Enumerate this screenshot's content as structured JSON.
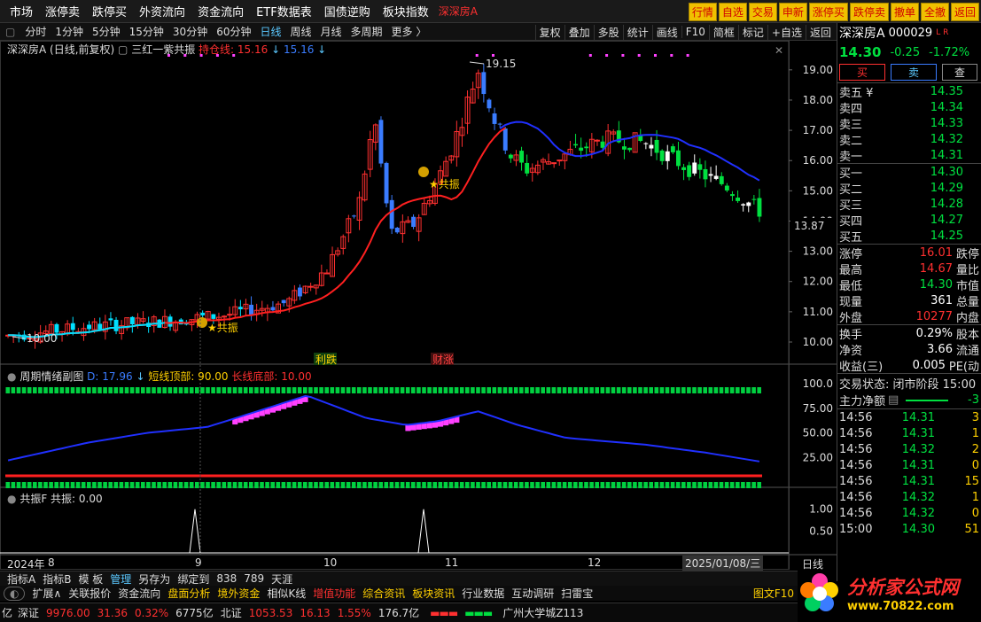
{
  "top_menu": {
    "items": [
      "市场",
      "涨停卖",
      "跌停买",
      "外资流向",
      "资金流向",
      "ETF数据表",
      "国债逆购",
      "板块指数"
    ],
    "stock_code": "深深房A"
  },
  "top_buttons": [
    "行情",
    "自选",
    "交易",
    "申新",
    "涨停买",
    "跌停卖",
    "撤单",
    "全撤",
    "返回"
  ],
  "period_bar": {
    "items": [
      "分时",
      "1分钟",
      "5分钟",
      "15分钟",
      "30分钟",
      "60分钟",
      "日线",
      "周线",
      "月线",
      "多周期",
      "更多 〉"
    ],
    "active": "日线"
  },
  "tool_buttons": [
    "复权",
    "叠加",
    "多股",
    "统计",
    "画线",
    "F10",
    "简框",
    "标记",
    "+自选",
    "返回"
  ],
  "main_legend": {
    "title": "深深房A (日线,前复权)",
    "indicator": "三红一紫共振",
    "hold_label": "持仓线: 15.16",
    "hold_value2": "15.16"
  },
  "price_labels": {
    "high": "19.15",
    "low": "10.00",
    "current": "13.87",
    "resonance1": "★共振",
    "resonance2": "★共振",
    "event1": "利跌",
    "event2": "财涨"
  },
  "price_axis": [
    "19.00",
    "18.00",
    "17.00",
    "16.00",
    "15.00",
    "14.00",
    "13.00",
    "12.00",
    "11.00",
    "10.00"
  ],
  "sub1_legend": {
    "title": "周期情绪副图",
    "d": "D: 17.96",
    "top": "短线顶部: 90.00",
    "bottom": "长线底部: 10.00"
  },
  "sub1_axis": [
    "100.0",
    "75.00",
    "50.00",
    "25.00"
  ],
  "sub2_legend": {
    "title": "共振F",
    "value": "共振: 0.00"
  },
  "sub2_axis": [
    "1.00",
    "0.50"
  ],
  "date_axis": {
    "year": "2024年",
    "months": [
      "8",
      "9",
      "10",
      "11",
      "12"
    ],
    "cursor_date": "2025/01/08/三",
    "period": "日线"
  },
  "chart_data": {
    "type": "candlestick",
    "title": "深深房A (日线,前复权)",
    "ylim": [
      10.0,
      19.2
    ],
    "high": 19.15,
    "low": 10.0,
    "last_marker": 13.87
  },
  "quote": {
    "name": "深深房A",
    "code": "000029",
    "flag": "L R",
    "price": "14.30",
    "change": "-0.25",
    "pct": "-1.72%",
    "buy_btn": "买",
    "sell_btn": "卖",
    "query_btn": "查",
    "asks": [
      {
        "l": "卖五 ¥",
        "v": "14.35",
        "c": "green"
      },
      {
        "l": "卖四",
        "v": "14.34",
        "c": "green"
      },
      {
        "l": "卖三",
        "v": "14.33",
        "c": "green"
      },
      {
        "l": "卖二",
        "v": "14.32",
        "c": "green"
      },
      {
        "l": "卖一",
        "v": "14.31",
        "c": "green"
      }
    ],
    "bids": [
      {
        "l": "买一",
        "v": "14.30",
        "c": "green"
      },
      {
        "l": "买二",
        "v": "14.29",
        "c": "green"
      },
      {
        "l": "买三",
        "v": "14.28",
        "c": "green"
      },
      {
        "l": "买四",
        "v": "14.27",
        "c": "green"
      },
      {
        "l": "买五",
        "v": "14.25",
        "c": "green"
      }
    ],
    "stats": [
      {
        "l": "涨停",
        "v": "16.01",
        "c": "red",
        "r": "跌停"
      },
      {
        "l": "最高",
        "v": "14.67",
        "c": "red",
        "r": "量比"
      },
      {
        "l": "最低",
        "v": "14.30",
        "c": "green",
        "r": "市值"
      },
      {
        "l": "现量",
        "v": "361",
        "c": "white",
        "r": "总量"
      },
      {
        "l": "外盘",
        "v": "10277",
        "c": "red",
        "r": "内盘"
      }
    ],
    "stats2": [
      {
        "l": "换手",
        "v": "0.29%",
        "c": "white",
        "r": "股本"
      },
      {
        "l": "净资",
        "v": "3.66",
        "c": "white",
        "r": "流通"
      },
      {
        "l": "收益(三)",
        "v": "0.005",
        "c": "white",
        "r": "PE(动"
      }
    ],
    "trade_status": "交易状态: 闭市阶段 15:00",
    "net_inflow": "主力净额",
    "net_inflow_val": "-3",
    "ticks": [
      {
        "t": "14:56",
        "p": "14.31",
        "v": "3"
      },
      {
        "t": "14:56",
        "p": "14.31",
        "v": "1"
      },
      {
        "t": "14:56",
        "p": "14.32",
        "v": "2"
      },
      {
        "t": "14:56",
        "p": "14.31",
        "v": "0"
      },
      {
        "t": "14:56",
        "p": "14.31",
        "v": "15"
      },
      {
        "t": "14:56",
        "p": "14.32",
        "v": "1"
      },
      {
        "t": "14:56",
        "p": "14.32",
        "v": "0"
      },
      {
        "t": "15:00",
        "p": "14.30",
        "v": "51"
      }
    ]
  },
  "bottom_bar1": [
    "指标A",
    "指标B",
    "模 板",
    "管理",
    "另存为",
    "绑定到",
    "838",
    "789",
    "天涯"
  ],
  "bottom_bar2": [
    "扩展∧",
    "关联报价",
    "资金流向",
    "盘面分析",
    "境外资金",
    "相似K线",
    "增值功能",
    "综合资讯",
    "板块资讯",
    "行业数据",
    "互动调研",
    "扫雷宝",
    "图文F10"
  ],
  "status_bar": {
    "prefix": "亿",
    "sz_label": "深证",
    "sz_val": "9976.00",
    "sz_chg": "31.36",
    "sz_pct": "0.32%",
    "sz_amt": "6775亿",
    "bz_label": "北证",
    "bz_val": "1053.53",
    "bz_chg": "16.13",
    "bz_pct": "1.55%",
    "bz_amt": "176.7亿",
    "location": "广州大学城Z113"
  },
  "logo": {
    "text": "分析家公式网",
    "url": "www.70822.com"
  }
}
